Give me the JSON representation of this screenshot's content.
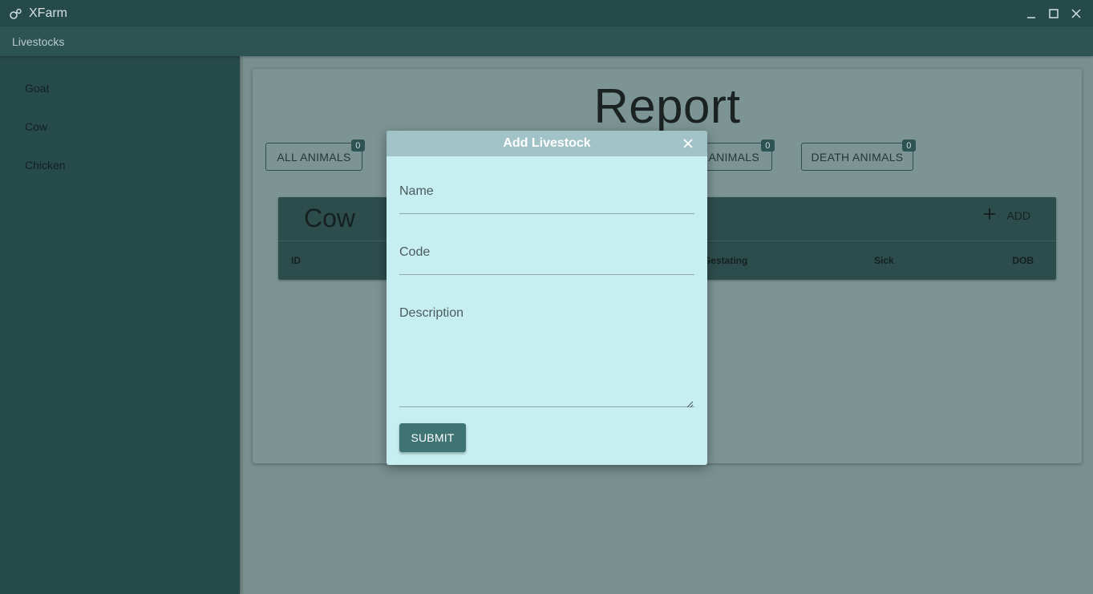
{
  "window": {
    "title": "XFarm",
    "icon": "farm-logo-icon",
    "controls": [
      "minimize-icon",
      "maximize-icon",
      "close-icon"
    ]
  },
  "menu": {
    "items": [
      {
        "label": "Livestocks"
      }
    ]
  },
  "sidebar": {
    "items": [
      {
        "label": "Goat"
      },
      {
        "label": "Cow"
      },
      {
        "label": "Chicken"
      }
    ]
  },
  "report": {
    "title": "Report",
    "stat_buttons": [
      {
        "label": "ALL ANIMALS",
        "count": "0"
      },
      {
        "label": "ANIMALS",
        "count": "0"
      },
      {
        "label": "DEATH ANIMALS",
        "count": "0"
      }
    ]
  },
  "table": {
    "title": "Cow",
    "add_label": "ADD",
    "columns": [
      "ID",
      "Gestating",
      "Sick",
      "DOB"
    ]
  },
  "modal": {
    "title": "Add Livestock",
    "fields": {
      "name_label": "Name",
      "code_label": "Code",
      "description_label": "Description"
    },
    "submit_label": "SUBMIT"
  },
  "colors": {
    "titlebar": "#264949",
    "sidebar": "#274a4a",
    "backdrop": "#78908f",
    "modal_bg": "#c7eff2",
    "modal_header": "#a1c3c7",
    "submit": "#3e7473"
  }
}
